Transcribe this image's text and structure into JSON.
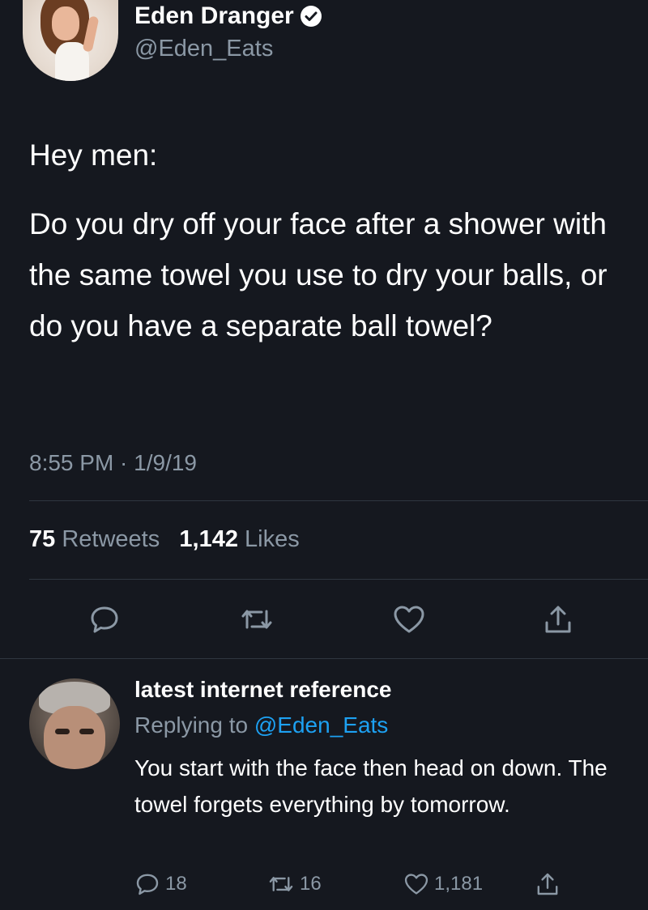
{
  "tweet": {
    "author": {
      "name": "Eden Dranger",
      "handle": "@Eden_Eats",
      "verified": true
    },
    "text": {
      "line1": "Hey men:",
      "line2": "Do you dry off your face after a shower with the same towel you use to dry your balls, or do you have a separate ball towel?"
    },
    "timestamp": "8:55 PM · 1/9/19",
    "stats": {
      "retweets_count": "75",
      "retweets_label": "Retweets",
      "likes_count": "1,142",
      "likes_label": "Likes"
    },
    "actions": [
      "reply-icon",
      "retweet-icon",
      "like-icon",
      "share-icon"
    ]
  },
  "reply": {
    "author": {
      "name": "latest internet reference"
    },
    "replying_prefix": "Replying to",
    "replying_mention": "@Eden_Eats",
    "text": "You start with the face then head on down. The towel forgets everything by tomorrow.",
    "counts": {
      "replies": "18",
      "retweets": "16",
      "likes": "1,181"
    }
  },
  "colors": {
    "background": "#15181f",
    "text_primary": "#ffffff",
    "text_secondary": "#8b98a5",
    "link": "#1da1f2",
    "divider": "#2f3640"
  }
}
